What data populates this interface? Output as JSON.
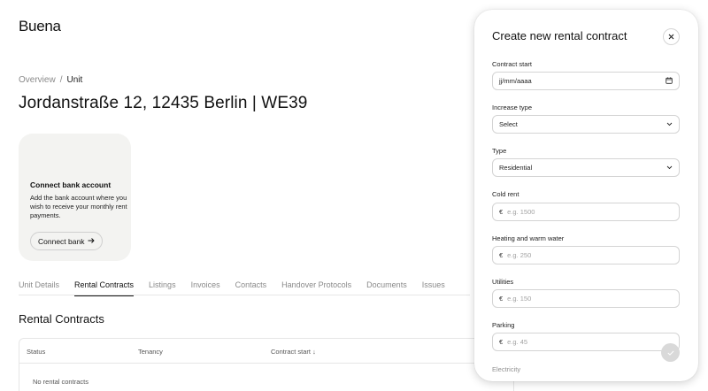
{
  "app": {
    "logo": "Buena"
  },
  "breadcrumb": {
    "items": [
      "Overview",
      "Unit"
    ],
    "separator": "/"
  },
  "page": {
    "title": "Jordanstraße 12, 12435 Berlin | WE39"
  },
  "bank_card": {
    "title": "Connect bank account",
    "text": "Add the bank account where you wish to receive your monthly rent payments.",
    "button_label": "Connect bank",
    "button_icon": "arrow-right-icon"
  },
  "tabs": [
    {
      "label": "Unit Details",
      "active": false
    },
    {
      "label": "Rental Contracts",
      "active": true
    },
    {
      "label": "Listings",
      "active": false
    },
    {
      "label": "Invoices",
      "active": false
    },
    {
      "label": "Contacts",
      "active": false
    },
    {
      "label": "Handover Protocols",
      "active": false
    },
    {
      "label": "Documents",
      "active": false
    },
    {
      "label": "Issues",
      "active": false
    }
  ],
  "section": {
    "title": "Rental Contracts"
  },
  "table": {
    "columns": [
      "Status",
      "Tenancy",
      "Contract start ↓"
    ],
    "empty_text": "No rental contracts"
  },
  "panel": {
    "title": "Create new rental contract",
    "close_icon": "close-icon",
    "fields": {
      "contract_start": {
        "label": "Contract start",
        "value": "jj/mm/aaaa",
        "icon": "calendar-icon"
      },
      "increase_type": {
        "label": "Increase type",
        "value": "Select",
        "icon": "chevron-down-icon"
      },
      "type": {
        "label": "Type",
        "value": "Residential",
        "icon": "chevron-down-icon"
      },
      "cold_rent": {
        "label": "Cold rent",
        "currency": "€",
        "placeholder": "e.g. 1500"
      },
      "heating": {
        "label": "Heating and warm water",
        "currency": "€",
        "placeholder": "e.g. 250"
      },
      "utilities": {
        "label": "Utilities",
        "currency": "€",
        "placeholder": "e.g. 150"
      },
      "parking": {
        "label": "Parking",
        "currency": "€",
        "placeholder": "e.g. 45"
      },
      "electricity": {
        "label": "Electricity"
      }
    },
    "fab_icon": "checkmark-icon"
  }
}
